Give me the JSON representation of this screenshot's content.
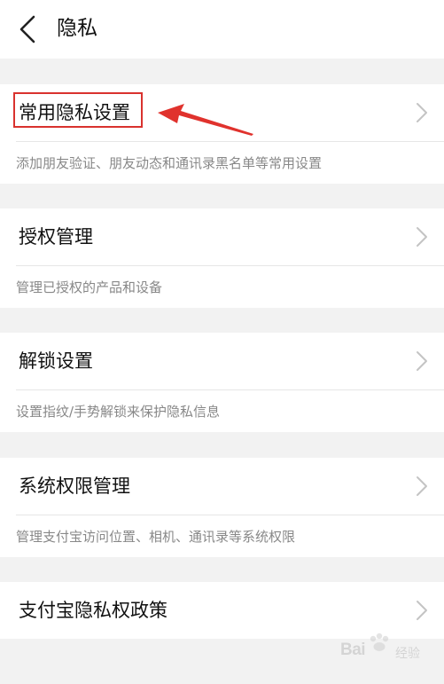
{
  "header": {
    "title": "隐私",
    "back_icon": "chevron-left-icon"
  },
  "sections": [
    {
      "label": "常用隐私设置",
      "description": "添加朋友验证、朋友动态和通讯录黑名单等常用设置"
    },
    {
      "label": "授权管理",
      "description": "管理已授权的产品和设备"
    },
    {
      "label": "解锁设置",
      "description": "设置指纹/手势解锁来保护隐私信息"
    },
    {
      "label": "系统权限管理",
      "description": "管理支付宝访问位置、相机、通讯录等系统权限"
    },
    {
      "label": "支付宝隐私权政策"
    }
  ],
  "annotation": {
    "color": "#d9322e"
  },
  "watermark": {
    "brand": "Bai",
    "suffix": "经验"
  },
  "colors": {
    "background": "#f2f2f2",
    "card": "#ffffff",
    "text": "#111111",
    "secondary_text": "#888888",
    "chevron": "#c4c4c4"
  }
}
